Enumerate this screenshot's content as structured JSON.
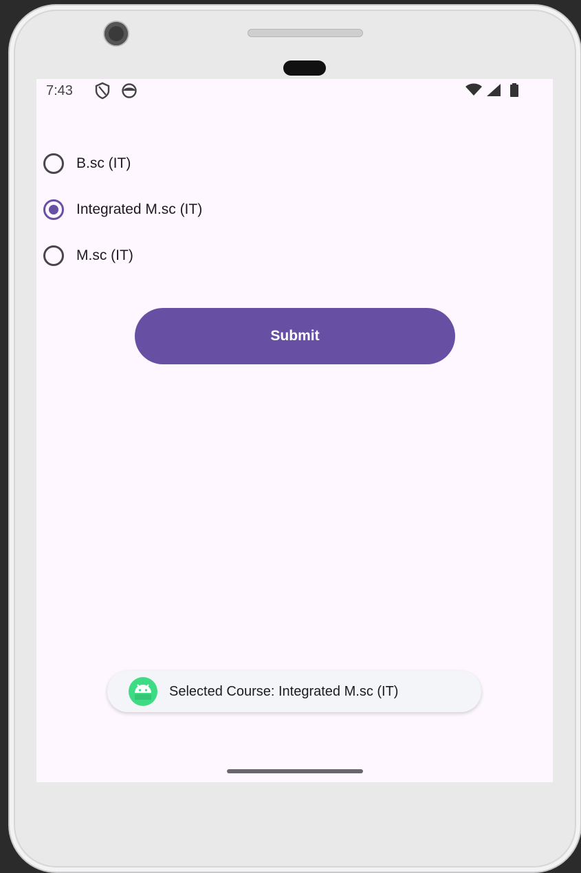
{
  "status_bar": {
    "time": "7:43",
    "left_icons": [
      "shield-icon",
      "notification-icon"
    ],
    "right_icons": [
      "wifi-icon",
      "signal-icon",
      "battery-icon"
    ]
  },
  "course_options": [
    {
      "label": "B.sc (IT)",
      "checked": false
    },
    {
      "label": "Integrated M.sc (IT)",
      "checked": true
    },
    {
      "label": "M.sc (IT)",
      "checked": false
    }
  ],
  "submit_button": {
    "label": "Submit"
  },
  "toast": {
    "icon": "android-icon",
    "message": "Selected Course: Integrated M.sc (IT)"
  },
  "colors": {
    "accent": "#6750a4",
    "screen_background": "#fef7ff",
    "toast_icon_green": "#3ddc84"
  }
}
